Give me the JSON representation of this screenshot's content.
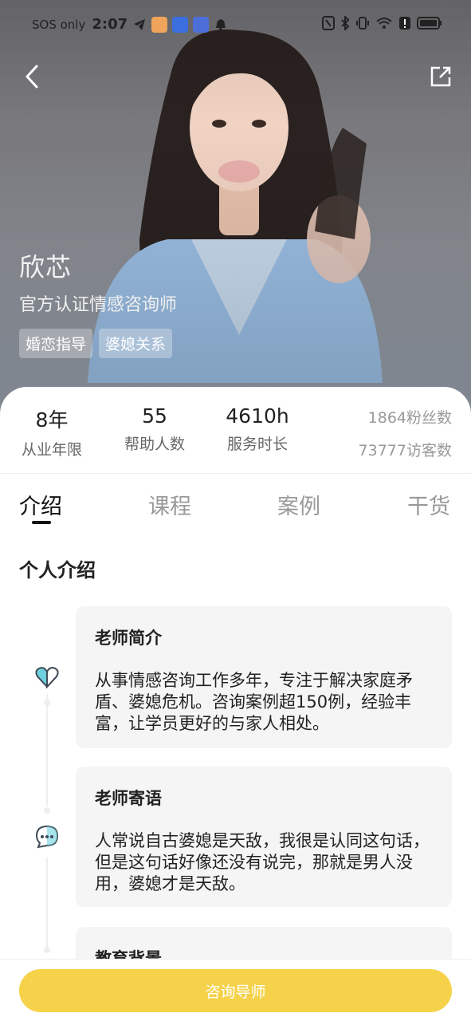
{
  "status_bar": {
    "carrier": "SOS only",
    "time": "2:07",
    "icons": [
      "telegram-icon",
      "app-badge-icon",
      "shield-app-icon",
      "card-app-icon",
      "bell-icon",
      "nfc-icon",
      "bluetooth-icon",
      "vibrate-icon",
      "wifi-icon",
      "alert-icon",
      "battery-icon"
    ]
  },
  "header": {
    "back_icon": "chevron-left-icon",
    "share_icon": "share-icon"
  },
  "mentor": {
    "name": "欣芯",
    "title": "官方认证情感咨询师",
    "tags": [
      "婚恋指导",
      "婆媳关系"
    ]
  },
  "stats": [
    {
      "value": "8年",
      "label": "从业年限"
    },
    {
      "value": "55",
      "label": "帮助人数"
    },
    {
      "value": "4610h",
      "label": "服务时长"
    }
  ],
  "side_stats": {
    "fans": "1864粉丝数",
    "visitors": "73777访客数"
  },
  "tabs": [
    {
      "label": "介绍",
      "active": true
    },
    {
      "label": "课程",
      "active": false
    },
    {
      "label": "案例",
      "active": false
    },
    {
      "label": "干货",
      "active": false
    }
  ],
  "section_title": "个人介绍",
  "sections": [
    {
      "icon": "heart-icon",
      "title": "老师简介",
      "text": "从事情感咨询工作多年，专注于解决家庭矛盾、婆媳危机。咨询案例超150例，经验丰富，让学员更好的与家人相处。"
    },
    {
      "icon": "chat-bubble-icon",
      "title": "老师寄语",
      "text": "人常说自古婆媳是天敌，我很是认同这句话，但是这句话好像还没有说完，那就是男人没用，婆媳才是天敌。"
    },
    {
      "icon": "",
      "title": "教育背景",
      "text": ""
    }
  ],
  "cta": {
    "label": "咨询导师"
  },
  "colors": {
    "accent": "#F5D24A",
    "tag_bg": "rgba(255,255,255,0.30)",
    "box_bg": "#F5F5F5"
  }
}
